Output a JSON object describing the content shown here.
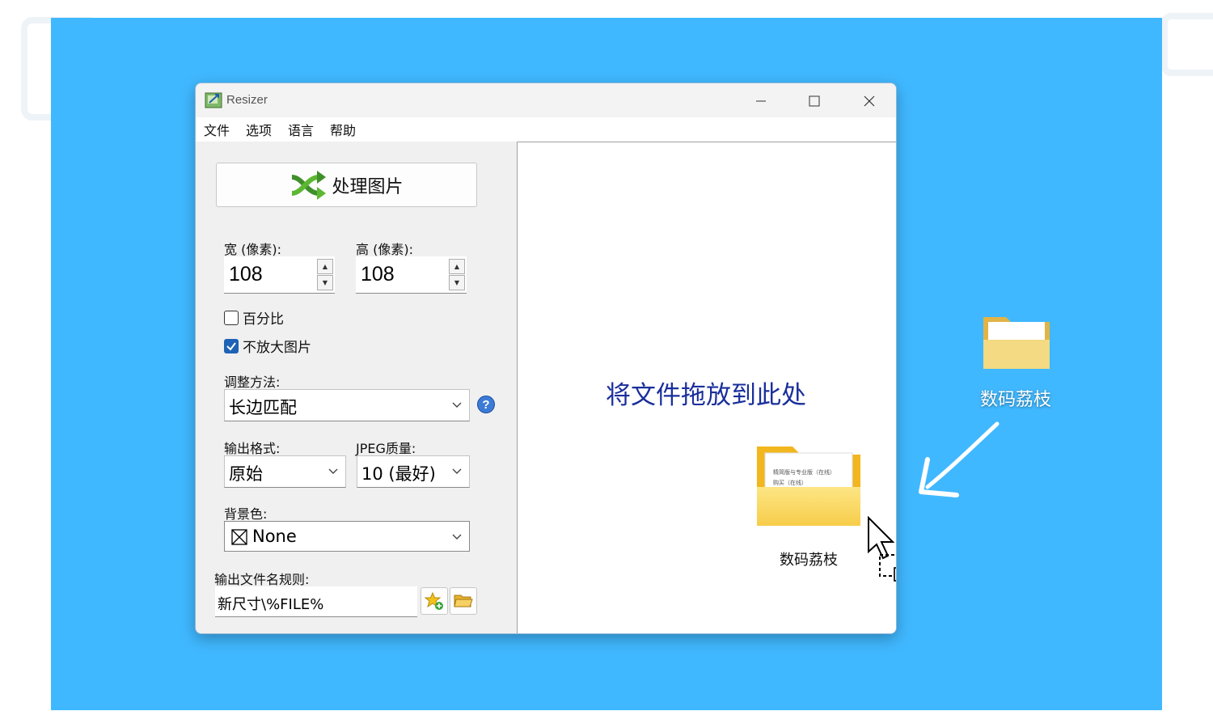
{
  "window": {
    "title": "Resizer",
    "controls": {
      "minimize": "minimize-icon",
      "maximize": "maximize-icon",
      "close": "close-icon"
    }
  },
  "menu": {
    "items": [
      "文件",
      "选项",
      "语言",
      "帮助"
    ]
  },
  "left": {
    "process_button": "处理图片",
    "width_label": "宽 (像素):",
    "width_value": "108",
    "height_label": "高 (像素):",
    "height_value": "108",
    "percent_label": "百分比",
    "percent_checked": false,
    "noenlarge_label": "不放大图片",
    "noenlarge_checked": true,
    "method_label": "调整方法:",
    "method_value": "长边匹配",
    "format_label": "输出格式:",
    "format_value": "原始",
    "jpeg_label": "JPEG质量:",
    "jpeg_value": "10 (最好)",
    "bg_label": "背景色:",
    "bg_value": "None",
    "filename_label": "输出文件名规则:",
    "filename_value": "新尺寸\\%FILE%"
  },
  "drop": {
    "hint": "将文件拖放到此处",
    "folder_label": "数码荔枝",
    "folder_doc_lines": [
      "精简版与专业版（在线）",
      "购买（在线）"
    ]
  },
  "desktop": {
    "folder_label": "数码荔枝"
  },
  "colors": {
    "stage_bg": "#40b8ff",
    "accent": "#1e63b5",
    "drop_hint": "#1a2f9b"
  }
}
